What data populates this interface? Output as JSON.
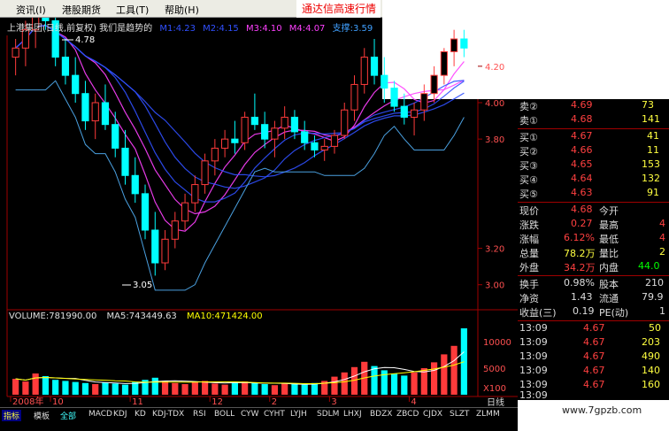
{
  "menu": {
    "items": [
      "资讯(I)",
      "港股期货",
      "工具(T)",
      "帮助(H)"
    ]
  },
  "ticker": "通达信高速行情",
  "header": {
    "stock_title": "上港集团(日线,前复权) 我们是趋势的",
    "ma_values": [
      "M1:4.23",
      "M2:4.15",
      "M3:4.10",
      "M4:4.07"
    ],
    "support": "支撑:3.59"
  },
  "price_axis": [
    "4.20",
    "4.00",
    "3.80",
    "3.20",
    "3.00"
  ],
  "annotations": {
    "high": "4.78",
    "low": "3.05"
  },
  "volume": {
    "volume_label": "VOLUME:781990.00",
    "ma5_label": "MA5:743449.63",
    "ma10_label": "MA10:471424.00",
    "axis": [
      "10000",
      "5000",
      "X100"
    ]
  },
  "date_axis": [
    "2008年",
    "10",
    "11",
    "12",
    "2",
    "3",
    "4"
  ],
  "quote_panel": {
    "asks": [
      {
        "label": "卖②",
        "price": "4.69",
        "vol": "73"
      },
      {
        "label": "卖①",
        "price": "4.68",
        "vol": "141"
      }
    ],
    "bids": [
      {
        "label": "买①",
        "price": "4.67",
        "vol": "41"
      },
      {
        "label": "买②",
        "price": "4.66",
        "vol": "11"
      },
      {
        "label": "买③",
        "price": "4.65",
        "vol": "153"
      },
      {
        "label": "买④",
        "price": "4.64",
        "vol": "132"
      },
      {
        "label": "买⑤",
        "price": "4.63",
        "vol": "91"
      }
    ],
    "stats": [
      {
        "l1": "现价",
        "v1": "4.68",
        "l2": "今开",
        "v2": ""
      },
      {
        "l1": "涨跌",
        "v1": "0.27",
        "l2": "最高",
        "v2": "4"
      },
      {
        "l1": "涨幅",
        "v1": "6.12%",
        "l2": "最低",
        "v2": "4"
      },
      {
        "l1": "总量",
        "v1": "78.2万",
        "l2": "量比",
        "v2": "2"
      },
      {
        "l1": "外盘",
        "v1": "34.2万",
        "l2": "内盘",
        "v2": "44.0"
      },
      {
        "l1": "换手",
        "v1": "0.98%",
        "l2": "股本",
        "v2": "210"
      },
      {
        "l1": "净资",
        "v1": "1.43",
        "l2": "流通",
        "v2": "79.9"
      },
      {
        "l1": "收益(三)",
        "v1": "0.19",
        "l2": "PE(动)",
        "v2": "1"
      }
    ],
    "ticks": [
      {
        "time": "13:09",
        "price": "4.67",
        "vol": "50"
      },
      {
        "time": "13:09",
        "price": "4.67",
        "vol": "203"
      },
      {
        "time": "13:09",
        "price": "4.67",
        "vol": "490"
      },
      {
        "time": "13:09",
        "price": "4.67",
        "vol": "140"
      },
      {
        "time": "13:09",
        "price": "4.67",
        "vol": "160"
      },
      {
        "time": "13:09",
        "price": "",
        "vol": ""
      }
    ]
  },
  "tabs": [
    "指标",
    "模板",
    "全部",
    "MACD",
    "KDJ",
    "KD",
    "KDJ-TDX",
    "RSI",
    "BOLL",
    "CYW",
    "CYHT",
    "LYJH",
    "SDLM",
    "LHXJ",
    "BDZX",
    "ZBCD",
    "CJDX",
    "SLZT",
    "ZLMM"
  ],
  "period_label": "日线",
  "side_tab": "笔",
  "watermark": "www.7gpzb.com",
  "colors": {
    "up": "#ff3b3b",
    "down": "#00ffff",
    "ma_blue": "#3050ff",
    "ma_pink": "#ff40ff",
    "accent_yellow": "#ffff00"
  },
  "chart_data": {
    "type": "candlestick",
    "title": "上港集团(日线,前复权)",
    "ylim": [
      2.95,
      4.35
    ],
    "categories_hint": [
      "2008年",
      "10",
      "11",
      "12",
      "2",
      "3",
      "4"
    ],
    "ohlc": [
      [
        4.25,
        4.35,
        4.15,
        4.3
      ],
      [
        4.3,
        4.45,
        4.2,
        4.4
      ],
      [
        4.4,
        4.6,
        4.3,
        4.55
      ],
      [
        4.55,
        4.7,
        4.4,
        4.45
      ],
      [
        4.45,
        4.5,
        4.2,
        4.25
      ],
      [
        4.25,
        4.35,
        4.1,
        4.15
      ],
      [
        4.15,
        4.25,
        4.0,
        4.05
      ],
      [
        4.05,
        4.12,
        3.85,
        3.9
      ],
      [
        3.9,
        4.05,
        3.8,
        4.0
      ],
      [
        4.0,
        4.1,
        3.85,
        3.88
      ],
      [
        3.88,
        3.95,
        3.7,
        3.75
      ],
      [
        3.75,
        3.85,
        3.55,
        3.6
      ],
      [
        3.6,
        3.7,
        3.45,
        3.5
      ],
      [
        3.5,
        3.55,
        3.25,
        3.3
      ],
      [
        3.3,
        3.4,
        3.05,
        3.12
      ],
      [
        3.12,
        3.3,
        3.08,
        3.25
      ],
      [
        3.25,
        3.4,
        3.2,
        3.35
      ],
      [
        3.35,
        3.5,
        3.3,
        3.45
      ],
      [
        3.45,
        3.6,
        3.4,
        3.55
      ],
      [
        3.55,
        3.72,
        3.5,
        3.68
      ],
      [
        3.68,
        3.8,
        3.6,
        3.75
      ],
      [
        3.75,
        3.85,
        3.7,
        3.8
      ],
      [
        3.8,
        3.9,
        3.72,
        3.78
      ],
      [
        3.78,
        3.95,
        3.74,
        3.92
      ],
      [
        3.92,
        4.05,
        3.85,
        3.88
      ],
      [
        3.88,
        3.95,
        3.75,
        3.8
      ],
      [
        3.8,
        3.9,
        3.7,
        3.86
      ],
      [
        3.86,
        3.98,
        3.8,
        3.92
      ],
      [
        3.92,
        3.96,
        3.8,
        3.84
      ],
      [
        3.84,
        3.9,
        3.74,
        3.78
      ],
      [
        3.78,
        3.82,
        3.7,
        3.74
      ],
      [
        3.74,
        3.8,
        3.68,
        3.76
      ],
      [
        3.76,
        3.85,
        3.72,
        3.82
      ],
      [
        3.82,
        4.0,
        3.8,
        3.96
      ],
      [
        3.96,
        4.15,
        3.9,
        4.1
      ],
      [
        4.1,
        4.3,
        4.05,
        4.25
      ],
      [
        4.25,
        4.35,
        4.1,
        4.15
      ],
      [
        4.15,
        4.25,
        4.0,
        4.08
      ],
      [
        4.08,
        4.12,
        3.95,
        3.98
      ],
      [
        3.98,
        4.05,
        3.88,
        3.92
      ],
      [
        3.92,
        4.0,
        3.82,
        3.96
      ],
      [
        3.96,
        4.1,
        3.9,
        4.05
      ],
      [
        4.05,
        4.2,
        4.0,
        4.15
      ],
      [
        4.15,
        4.3,
        4.1,
        4.28
      ],
      [
        4.28,
        4.4,
        4.2,
        4.35
      ],
      [
        4.35,
        4.4,
        4.25,
        4.3
      ]
    ],
    "volume_hundreds": [
      3000,
      2500,
      4000,
      3500,
      2800,
      2600,
      2400,
      2200,
      2000,
      2300,
      2100,
      1900,
      2400,
      2800,
      3200,
      2600,
      2200,
      2000,
      2400,
      2600,
      2100,
      1900,
      2300,
      2500,
      2200,
      2000,
      1800,
      2100,
      2000,
      1900,
      2200,
      2600,
      3400,
      4200,
      5200,
      6200,
      5400,
      4600,
      4000,
      3600,
      4200,
      5000,
      6100,
      7600,
      9200,
      12500
    ]
  }
}
